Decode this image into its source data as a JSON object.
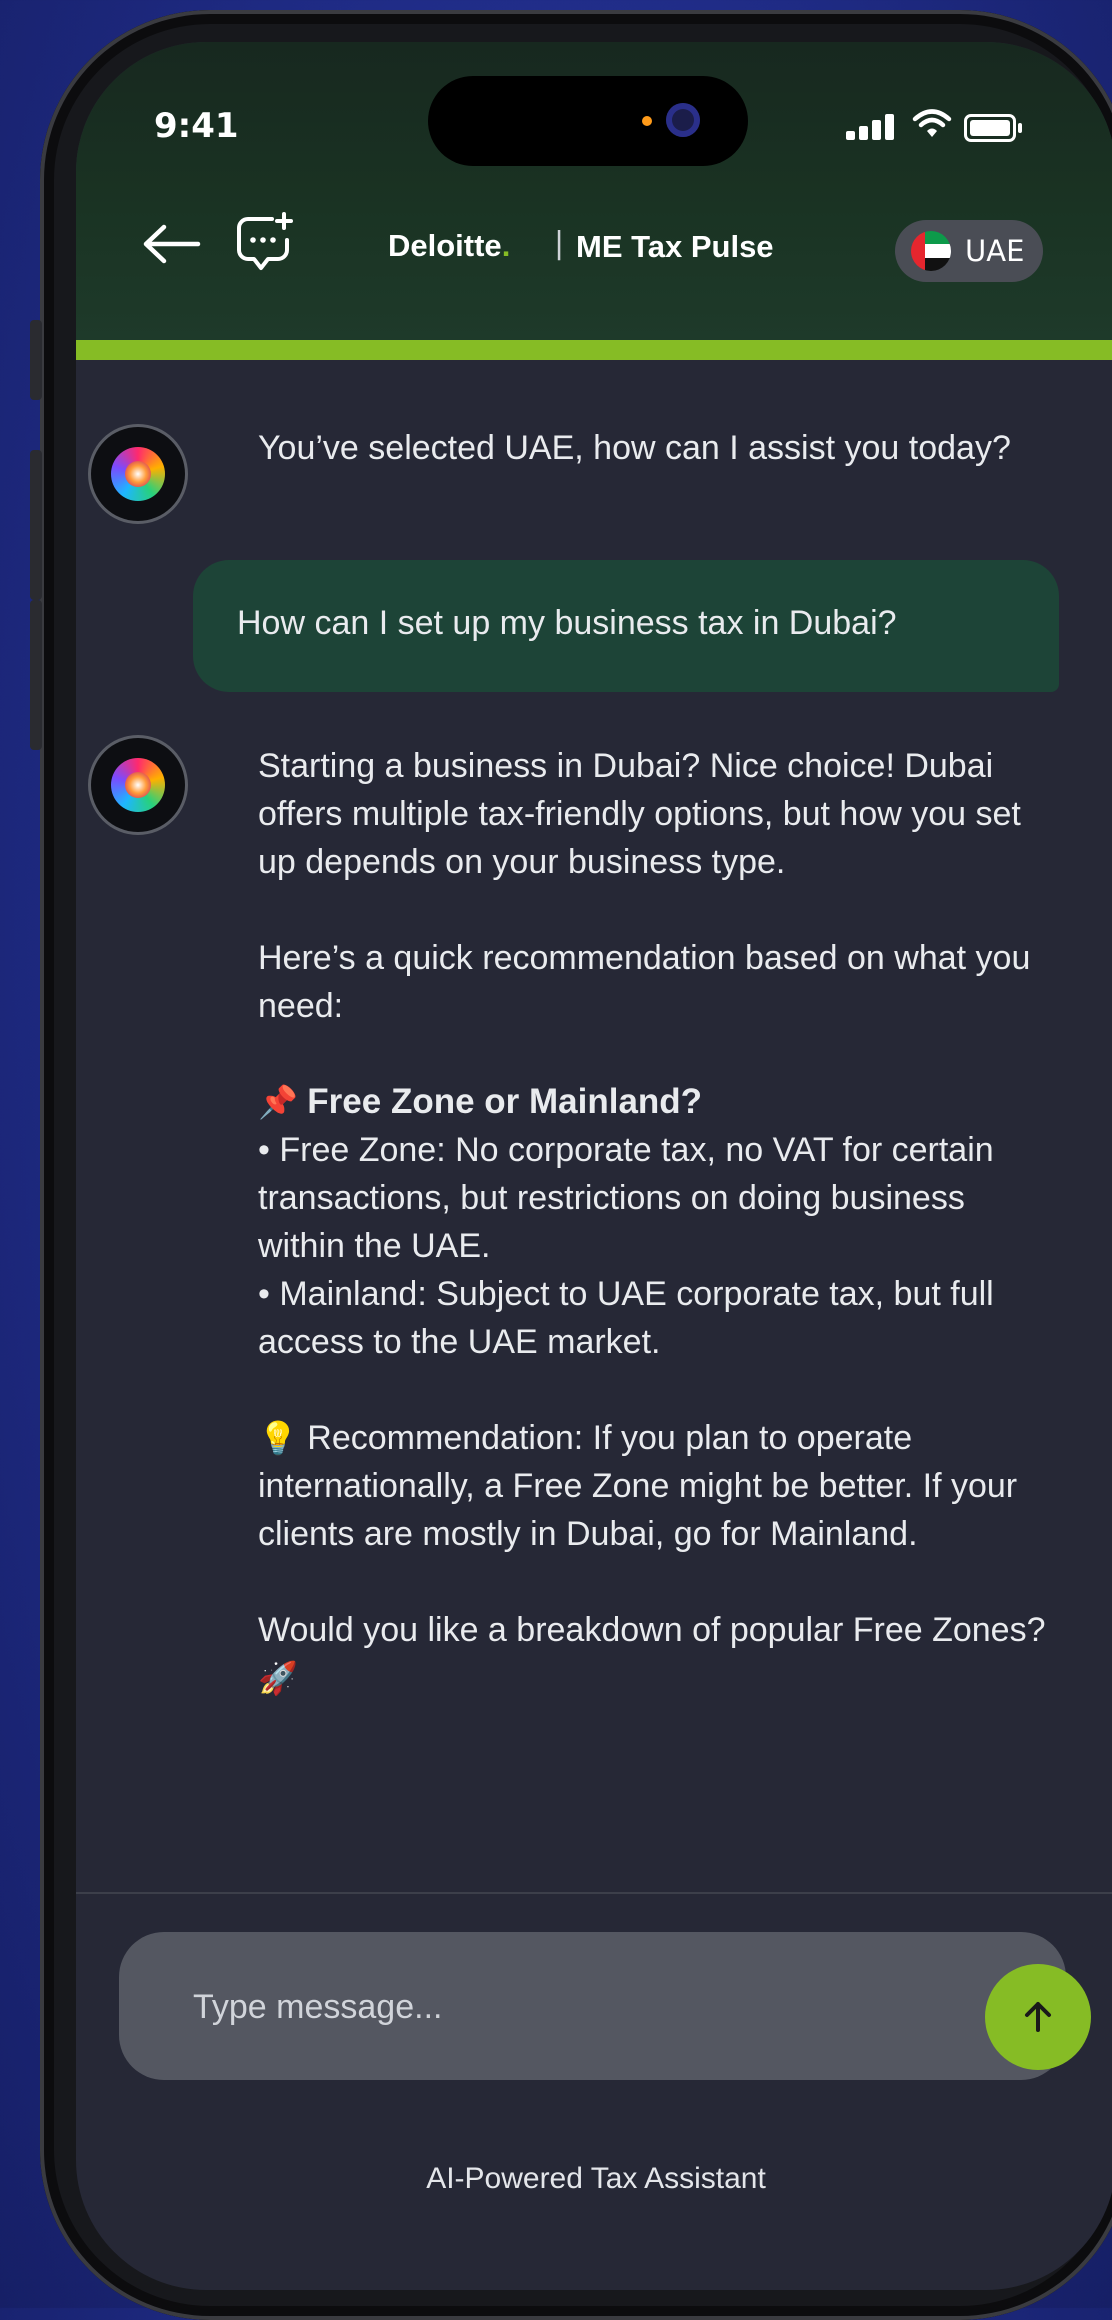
{
  "status_bar": {
    "time": "9:41"
  },
  "header": {
    "brand": "Deloitte",
    "brand_dot": ".",
    "separator": "|",
    "app_name": "ME Tax Pulse",
    "country": "UAE"
  },
  "chat": {
    "bot_greeting": "You’ve selected UAE, how can I assist you today?",
    "user_message": "How can I set up my business tax in Dubai?",
    "bot_reply": {
      "intro": "Starting a business in Dubai? Nice choice! Dubai offers multiple tax-friendly options, but how you set up depends on your business type.",
      "lead": "Here’s a quick recommendation based on what you need:",
      "heading_emoji": "📌",
      "heading": "Free Zone or Mainland?",
      "bullet_free_zone": "• Free Zone: No corporate tax, no VAT for certain transactions, but restrictions on doing business within the UAE.",
      "bullet_mainland": "• Mainland: Subject to UAE corporate tax, but full access to the UAE market.",
      "recommendation_emoji": "💡",
      "recommendation": "Recommendation: If you plan to operate internationally, a Free Zone might be better. If your clients are mostly in Dubai, go for Mainland.",
      "closing": "Would you like a breakdown of popular Free Zones?",
      "closing_emoji": "🚀"
    }
  },
  "composer": {
    "placeholder": "Type message..."
  },
  "footer": {
    "tagline": "AI-Powered Tax Assistant"
  },
  "colors": {
    "accent_green": "#86bc25",
    "user_bubble": "#1d4437",
    "background": "#262836",
    "input_bg": "#545761"
  },
  "icons": [
    "back-arrow-icon",
    "new-chat-icon",
    "uae-flag-icon",
    "bot-avatar-icon",
    "send-arrow-icon",
    "signal-icon",
    "wifi-icon",
    "battery-icon"
  ]
}
